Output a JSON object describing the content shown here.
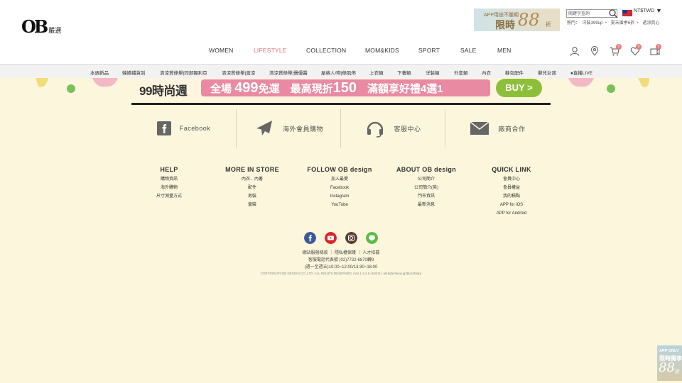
{
  "header": {
    "logo_ob": "OB",
    "logo_sub": "嚴選",
    "app_banner": {
      "line1": "APP用途不嚴期",
      "line2": "限時",
      "line3": "88",
      "line4": "折"
    },
    "search_placeholder": "關鍵字查詢",
    "currency": "NT$TWD",
    "caret": "▼",
    "top_links": [
      "熱門：",
      "洋裝399up",
      "・",
      "夏末搶季6折",
      "・",
      "透涼質心"
    ]
  },
  "main_nav": [
    {
      "label": "WOMEN",
      "active": false
    },
    {
      "label": "LIFESTYLE",
      "active": true
    },
    {
      "label": "COLLECTION",
      "active": false
    },
    {
      "label": "MOM&KIDS",
      "active": false
    },
    {
      "label": "SPORT",
      "active": false
    },
    {
      "label": "SALE",
      "active": false
    },
    {
      "label": "MEN",
      "active": false
    }
  ],
  "icons": {
    "cart_count": "0",
    "wishlist_count": "0",
    "notice_count": "0"
  },
  "sub_nav": [
    "本週新品",
    "韓嬌補貨到",
    "清涼質條舉|同部獨利亞",
    "清涼質條舉|渡涼",
    "清涼質條舉|聲優醬",
    "屋格人/吻|條肌佈",
    "上衣類",
    "下著類",
    "洋裝類",
    "外套類",
    "內衣",
    "鞋包配件",
    "嬰兒女孩",
    "●直播LIVE"
  ],
  "promo": {
    "text1": "99時尚週",
    "text2a": "全場",
    "text2b": "499",
    "text2c": "免運　最高現折",
    "text2d": "150",
    "text2e": "　滿額享好禮4選1",
    "buy": "BUY >"
  },
  "services": [
    {
      "label": "Facebook"
    },
    {
      "label": "海外會員購物"
    },
    {
      "label": "客服中心"
    },
    {
      "label": "廠商合作"
    }
  ],
  "footer_cols": [
    {
      "title": "HELP",
      "links": [
        "購物資訊",
        "海外購物",
        "尺寸測量方式"
      ]
    },
    {
      "title": "MORE IN STORE",
      "links": [
        "內衣．內著",
        "配件",
        "男裝",
        "童裝"
      ]
    },
    {
      "title": "FOLLOW OB design",
      "links": [
        "加入最愛",
        "Facebook",
        "Instagram",
        "YouTube"
      ]
    },
    {
      "title": "ABOUT OB design",
      "links": [
        "公司簡介",
        "公司簡介(英)",
        "門市資訊",
        "最新消息"
      ]
    },
    {
      "title": "QUICK LINK",
      "links": [
        "會員中心",
        "會員權益",
        "我的積點",
        "APP for iOS",
        "APP for Android"
      ]
    }
  ],
  "info_lines": [
    "網站服務條款 ｜ 隱私權保護 ｜ 人才招募",
    "客服電話代表號 (02)7722-6870轉9",
    "(週一至週五)10:00~12:00/13:30~18:00"
  ],
  "copyright": "COPYRIGHT©OB DESIGN CO.,LTD. ALL RIGHTS RESERVED. (Ver.1.3.4.6 | KW11 | akrkqfemkeuug3blocl45sp)",
  "float_app": {
    "a1": "APP ONLY",
    "a2": "限時獨享",
    "a3": "88",
    "a4": "折"
  },
  "colors": {
    "accent_pink": "#e3707a",
    "footer_bg": "#fbf6dc",
    "buy_green": "#8dbf3a",
    "promo_pink": "#e98aa2"
  }
}
